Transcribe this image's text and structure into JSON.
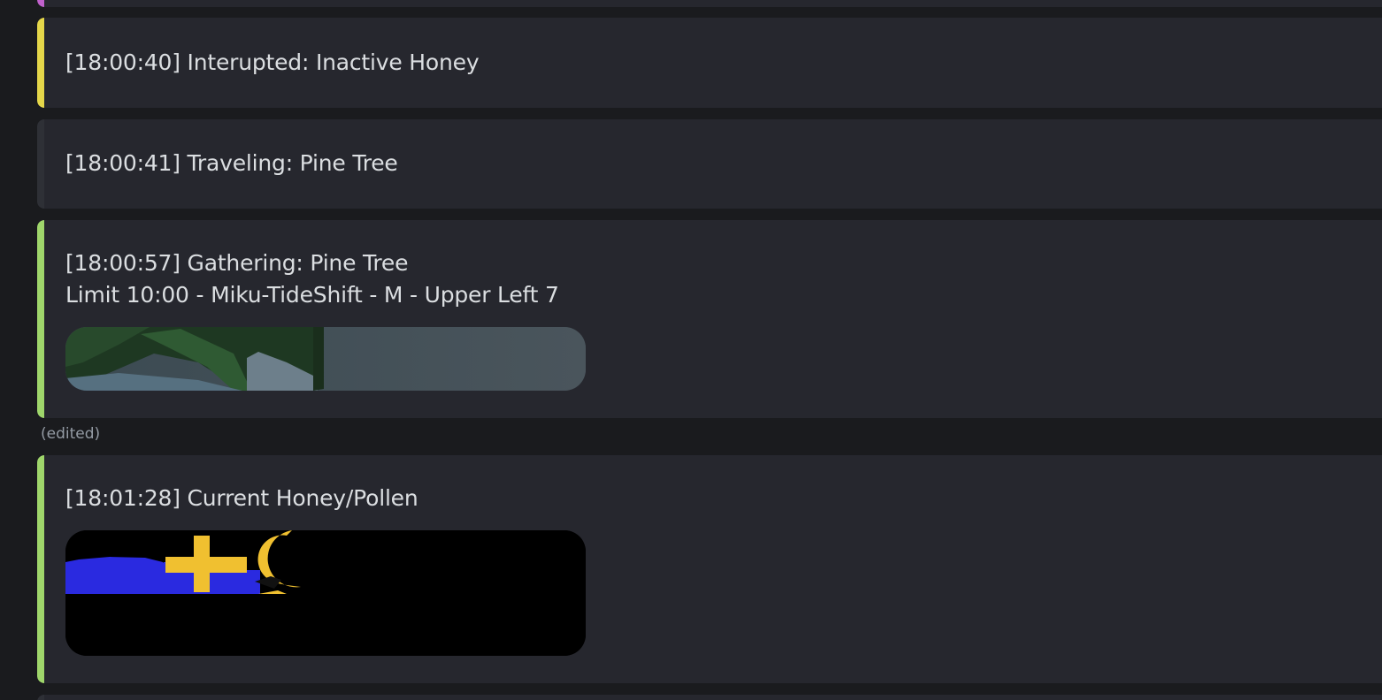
{
  "messages": [
    {
      "id": "top-partial",
      "lines": [],
      "accent": "#c061cb"
    },
    {
      "id": "msg-1",
      "lines": [
        "[18:00:40] Interupted: Inactive Honey"
      ],
      "accent": "#e5d74a"
    },
    {
      "id": "msg-2",
      "lines": [
        "[18:00:41] Traveling: Pine Tree"
      ],
      "accent": "#2b2d31"
    },
    {
      "id": "msg-3",
      "lines": [
        "[18:00:57] Gathering: Pine Tree",
        "Limit 10:00 - Miku-TideShift - M - Upper Left 7"
      ],
      "accent": "#9fd66b",
      "edited_label": "(edited)"
    },
    {
      "id": "msg-4",
      "lines": [
        "[18:01:28] Current Honey/Pollen"
      ],
      "accent": "#9fd66b"
    },
    {
      "id": "bottom-partial",
      "lines": [],
      "accent": "#2b2d31"
    }
  ],
  "colors": {
    "background": "#1a1b1e",
    "embed_bg": "#26272e",
    "text": "#dbdee1",
    "muted": "#949ba4"
  },
  "icons": {
    "msg3_image": "game-screenshot-pine-tree",
    "msg4_image": "game-screenshot-honey-pollen"
  }
}
